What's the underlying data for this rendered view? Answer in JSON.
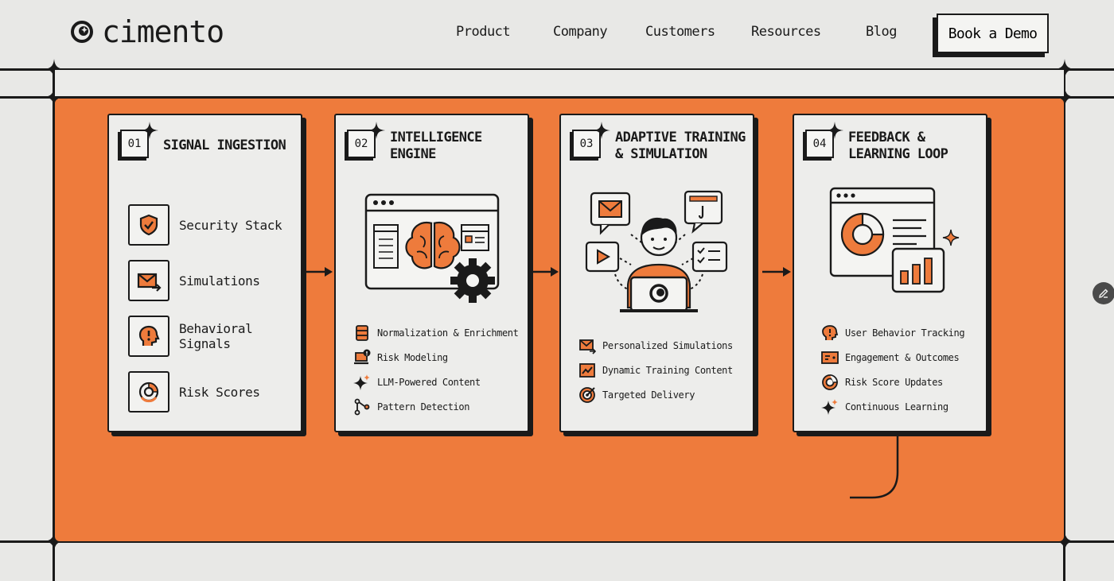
{
  "brand": {
    "name": "cimento"
  },
  "nav": {
    "items": [
      "Product",
      "Company",
      "Customers",
      "Resources",
      "Blog"
    ],
    "cta": "Book a Demo"
  },
  "colors": {
    "accent": "#ee7b3c",
    "ink": "#1a1a1a",
    "background": "#e8e8e6",
    "card": "#ededeb"
  },
  "steps": [
    {
      "number": "01",
      "title": "SIGNAL INGESTION",
      "items": [
        {
          "label": "Security Stack",
          "icon": "shield-check-icon"
        },
        {
          "label": "Simulations",
          "icon": "mail-arrow-icon"
        },
        {
          "label": "Behavioral\nSignals",
          "icon": "head-alert-icon"
        },
        {
          "label": "Risk Scores",
          "icon": "risk-gauge-icon"
        }
      ]
    },
    {
      "number": "02",
      "title": "INTELLIGENCE\nENGINE",
      "illustration": "brain-window-gear-illustration",
      "items": [
        {
          "label": "Normalization & Enrichment",
          "icon": "database-icon"
        },
        {
          "label": "Risk Modeling",
          "icon": "laptop-alert-icon"
        },
        {
          "label": "LLM-Powered Content",
          "icon": "sparkle-icon"
        },
        {
          "label": "Pattern Detection",
          "icon": "flow-icon"
        }
      ]
    },
    {
      "number": "03",
      "title": "ADAPTIVE TRAINING\n& SIMULATION",
      "illustration": "person-laptop-illustration",
      "items": [
        {
          "label": "Personalized Simulations",
          "icon": "mail-icon"
        },
        {
          "label": "Dynamic Training Content",
          "icon": "trend-chart-icon"
        },
        {
          "label": "Targeted Delivery",
          "icon": "target-icon"
        }
      ]
    },
    {
      "number": "04",
      "title": "FEEDBACK &\nLEARNING LOOP",
      "illustration": "dashboard-chart-illustration",
      "items": [
        {
          "label": "User Behavior Tracking",
          "icon": "head-alert-icon"
        },
        {
          "label": "Engagement & Outcomes",
          "icon": "card-icon"
        },
        {
          "label": "Risk Score Updates",
          "icon": "risk-gauge-icon"
        },
        {
          "label": "Continuous Learning",
          "icon": "sparkle-icon"
        }
      ]
    }
  ]
}
